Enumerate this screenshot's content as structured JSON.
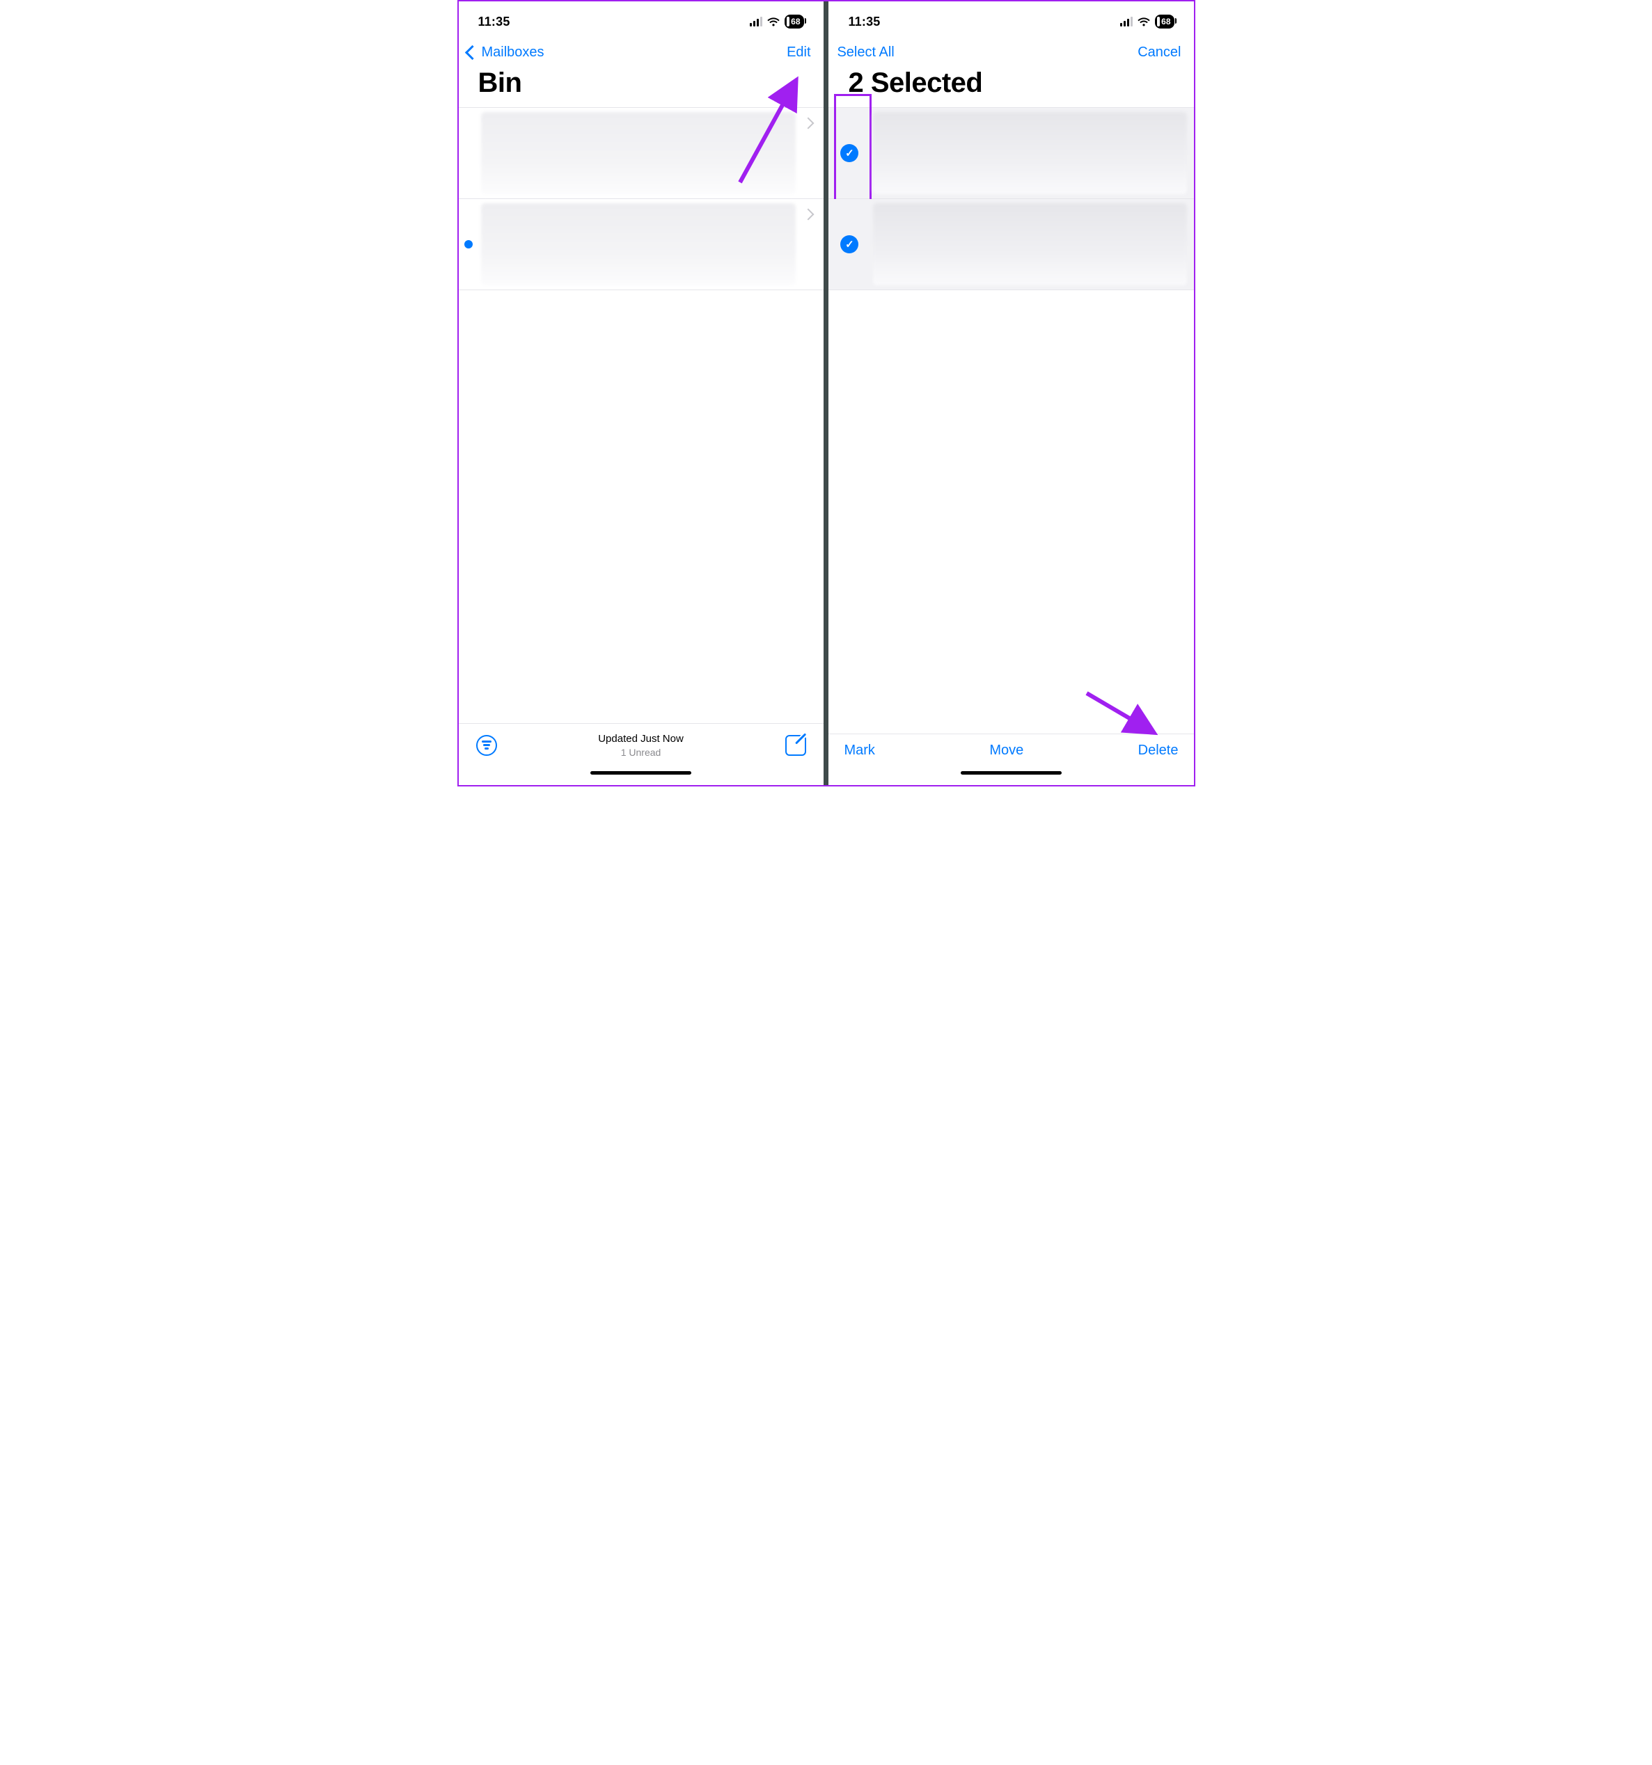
{
  "status": {
    "time": "11:35",
    "battery": "68"
  },
  "left_screen": {
    "nav": {
      "back_label": "Mailboxes",
      "right_label": "Edit"
    },
    "title": "Bin",
    "toolbar": {
      "updated": "Updated Just Now",
      "unread": "1 Unread"
    }
  },
  "right_screen": {
    "nav": {
      "left_label": "Select All",
      "right_label": "Cancel"
    },
    "title": "2 Selected",
    "toolbar": {
      "mark": "Mark",
      "move": "Move",
      "delete": "Delete"
    }
  }
}
